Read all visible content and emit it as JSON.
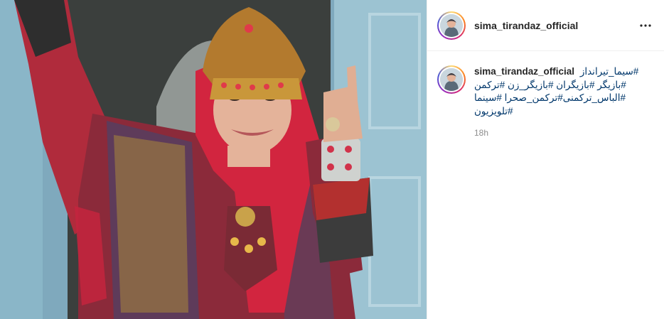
{
  "post": {
    "image_alt": "Woman in traditional Turkmen dress with ornate headdress and red scarf, standing in a blue doorway",
    "colors": {
      "door_blue": "#8fb6c9",
      "scarf_red": "#d2253f",
      "jacket_red": "#b32a3a",
      "gold": "#c9973a"
    }
  },
  "header": {
    "username": "sima_tirandaz_official",
    "more_icon": "more-horizontal-icon"
  },
  "caption": {
    "username": "sima_tirandaz_official",
    "text": "#سیما_تیرانداز #بازیگر #بازیگران #بازیگر_زن #ترکمن #الباس_ترکمنی#ترکمن_صحرا #سینما #تلویزیون",
    "time": "18h"
  }
}
